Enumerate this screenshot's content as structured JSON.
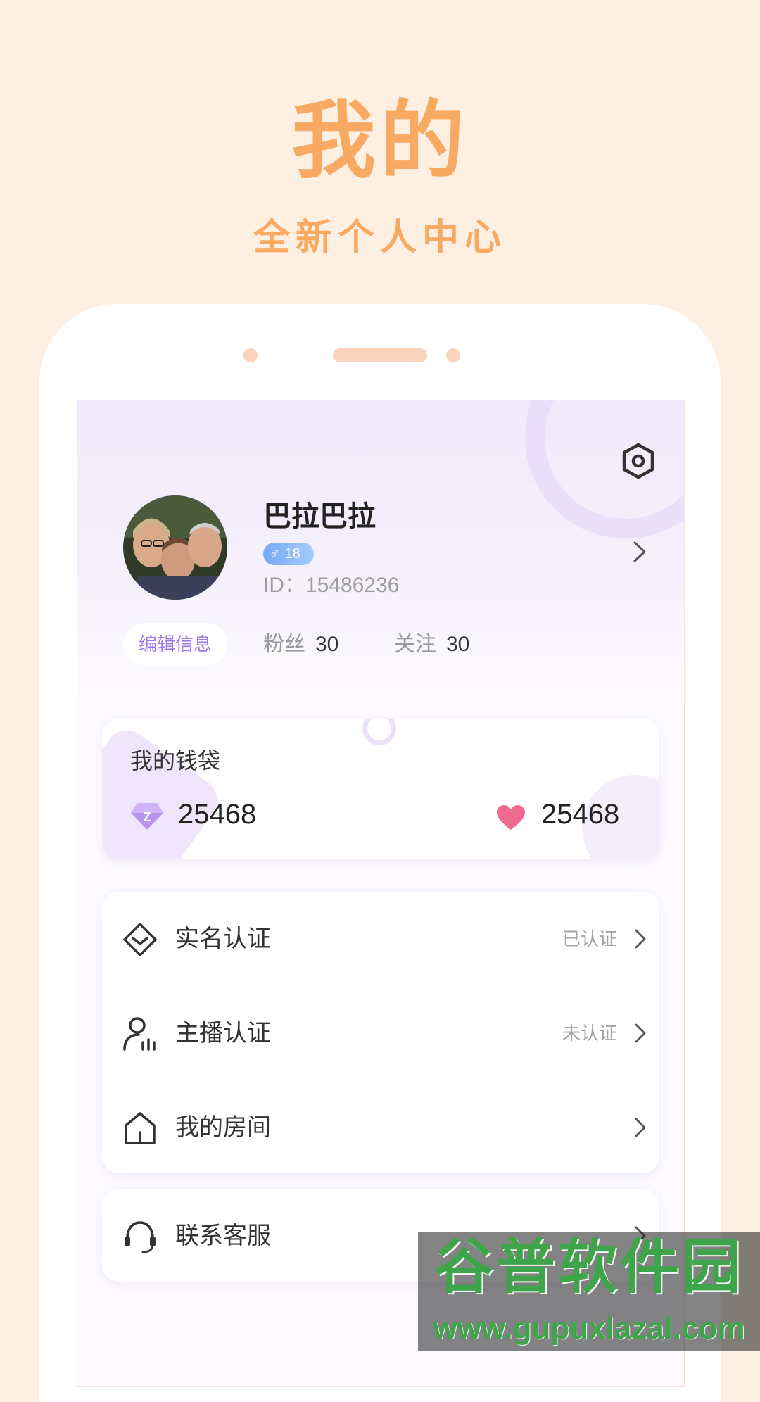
{
  "promo": {
    "title": "我的",
    "subtitle": "全新个人中心"
  },
  "profile": {
    "name": "巴拉巴拉",
    "gender_symbol": "♂",
    "age": "18",
    "id_text": "ID：15486236",
    "edit_label": "编辑信息",
    "fans_label": "粉丝",
    "fans_count": "30",
    "follow_label": "关注",
    "follow_count": "30"
  },
  "wallet": {
    "title": "我的钱袋",
    "coin_letter": "Z",
    "coins": "25468",
    "hearts": "25468"
  },
  "menu": [
    {
      "label": "实名认证",
      "status": "已认证",
      "icon": "id-verify-icon"
    },
    {
      "label": "主播认证",
      "status": "未认证",
      "icon": "streamer-icon"
    },
    {
      "label": "我的房间",
      "status": "",
      "icon": "home-icon"
    },
    {
      "label": "联系客服",
      "status": "",
      "icon": "headset-icon"
    }
  ],
  "watermark": {
    "line1": "谷普软件园",
    "line2": "www.gupuxlazal.com"
  },
  "colors": {
    "accent": "#f8aa63",
    "purple": "#9b7be8",
    "heart": "#f06a8e",
    "background": "#fdf0e3"
  }
}
